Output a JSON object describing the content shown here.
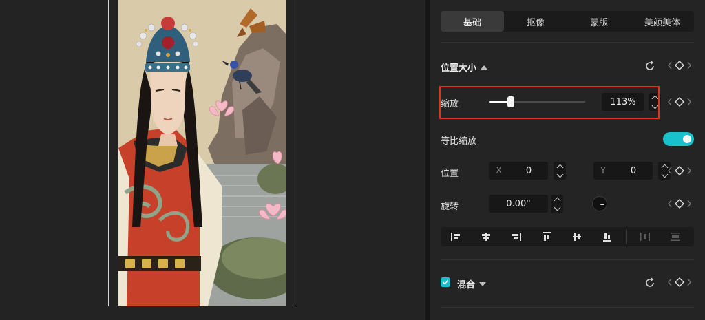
{
  "tabs": [
    {
      "label": "基础",
      "active": true
    },
    {
      "label": "抠像",
      "active": false
    },
    {
      "label": "蒙版",
      "active": false
    },
    {
      "label": "美颜美体",
      "active": false
    }
  ],
  "position_size": {
    "title": "位置大小",
    "scale": {
      "label": "缩放",
      "value": "113%",
      "slider_percent": 23
    },
    "uniform_scale": {
      "label": "等比缩放",
      "enabled": true
    },
    "position": {
      "label": "位置",
      "x_label": "X",
      "x_value": "0",
      "y_label": "Y",
      "y_value": "0"
    },
    "rotation": {
      "label": "旋转",
      "value": "0.00°"
    }
  },
  "align_icons": [
    "align-left-icon",
    "align-center-h-icon",
    "align-right-icon",
    "align-top-icon",
    "align-center-v-icon",
    "align-bottom-icon",
    "distribute-h-icon",
    "distribute-v-icon"
  ],
  "blend": {
    "title": "混合",
    "checked": true
  },
  "colors": {
    "accent": "#19c1cc",
    "highlight": "#e8301a",
    "panel": "#242424",
    "field": "#171717"
  }
}
